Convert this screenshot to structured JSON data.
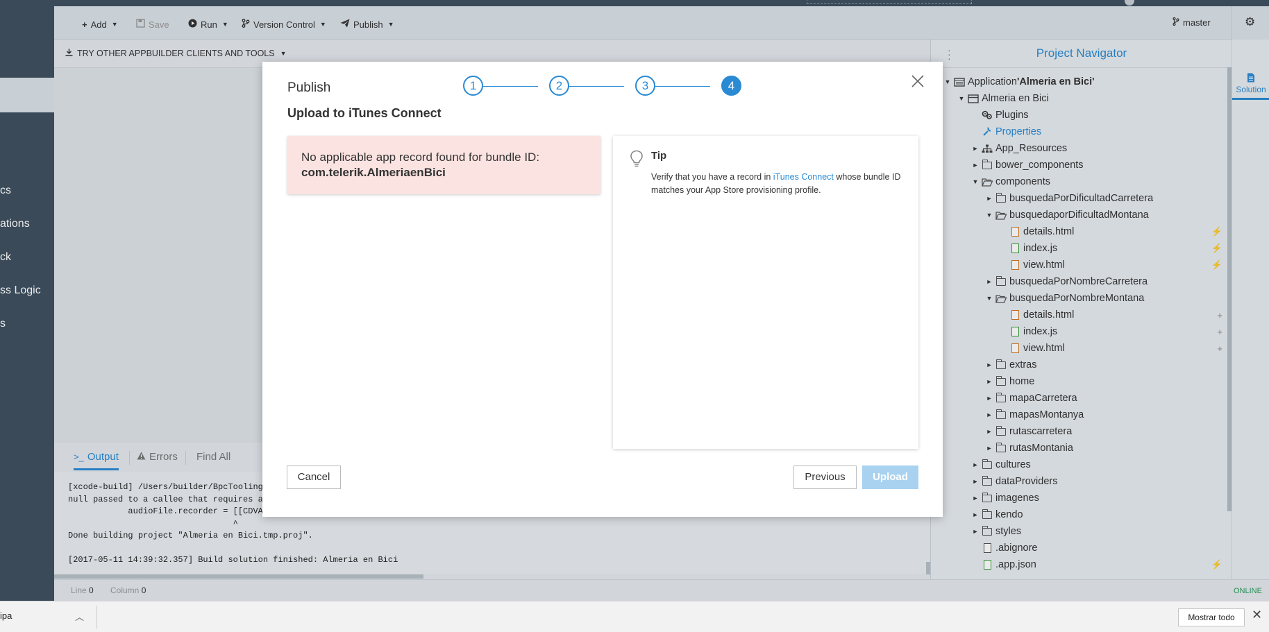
{
  "sidebar": {
    "items": [
      {
        "label": "cs"
      },
      {
        "label": "ations"
      },
      {
        "label": "ck"
      },
      {
        "label": "ss Logic"
      },
      {
        "label": "s"
      }
    ]
  },
  "toolbar": {
    "add_label": "Add",
    "save_label": "Save",
    "run_label": "Run",
    "version_control_label": "Version Control",
    "publish_label": "Publish",
    "branch_label": "master"
  },
  "subbar": {
    "try_other_label": "TRY OTHER APPBUILDER CLIENTS AND TOOLS"
  },
  "output_panel": {
    "tabs": [
      {
        "label": "Output"
      },
      {
        "label": "Errors"
      },
      {
        "label": "Find All"
      }
    ],
    "lines": [
      "[xcode-build] /Users/builder/BpcTooling/",
      "null passed to a callee that requires a",
      "            audioFile.recorder = [[CDVAu",
      "                                 ^",
      "Done building project \"Almeria en Bici.tmp.proj\".",
      "",
      "[2017-05-11 14:39:32.357] Build solution finished: Almeria en Bici"
    ]
  },
  "statusbar": {
    "line_label": "Line",
    "line_value": "0",
    "column_label": "Column",
    "column_value": "0",
    "connection_status": "ONLINE"
  },
  "navigator": {
    "title": "Project Navigator",
    "tab_label": "Solution",
    "tree": [
      {
        "label": "Application ",
        "bold_suffix": "'Almeria en Bici'",
        "type": "app"
      },
      {
        "label": "Almeria en Bici",
        "type": "project"
      },
      {
        "label": "Plugins",
        "type": "plugins"
      },
      {
        "label": "Properties",
        "type": "properties"
      },
      {
        "label": "App_Resources",
        "type": "folder"
      },
      {
        "label": "bower_components",
        "type": "folder"
      },
      {
        "label": "components",
        "type": "folder-open"
      },
      {
        "label": "busquedaPorDificultadCarretera",
        "type": "folder"
      },
      {
        "label": "busquedaporDificultadMontana",
        "type": "folder-open"
      },
      {
        "label": "details.html",
        "type": "html",
        "action": "⚡"
      },
      {
        "label": "index.js",
        "type": "js",
        "action": "⚡"
      },
      {
        "label": "view.html",
        "type": "html",
        "action": "⚡"
      },
      {
        "label": "busquedaPorNombreCarretera",
        "type": "folder"
      },
      {
        "label": "busquedaPorNombreMontana",
        "type": "folder-open"
      },
      {
        "label": "details.html",
        "type": "html",
        "action": "+"
      },
      {
        "label": "index.js",
        "type": "js",
        "action": "+"
      },
      {
        "label": "view.html",
        "type": "html",
        "action": "+"
      },
      {
        "label": "extras",
        "type": "folder"
      },
      {
        "label": "home",
        "type": "folder"
      },
      {
        "label": "mapaCarretera",
        "type": "folder"
      },
      {
        "label": "mapasMontanya",
        "type": "folder"
      },
      {
        "label": "rutascarretera",
        "type": "folder"
      },
      {
        "label": "rutasMontania",
        "type": "folder"
      },
      {
        "label": "cultures",
        "type": "folder"
      },
      {
        "label": "dataProviders",
        "type": "folder"
      },
      {
        "label": "imagenes",
        "type": "folder"
      },
      {
        "label": "kendo",
        "type": "folder"
      },
      {
        "label": "styles",
        "type": "folder"
      },
      {
        "label": ".abignore",
        "type": "file"
      },
      {
        "label": ".app.json",
        "type": "js",
        "action": "⚡"
      }
    ]
  },
  "modal": {
    "title": "Publish",
    "subtitle": "Upload to iTunes Connect",
    "steps": [
      "1",
      "2",
      "3",
      "4"
    ],
    "active_step": 4,
    "error_line1": "No applicable app record found for bundle ID:",
    "error_bundle": "com.telerik.AlmeriaenBici",
    "tip_title": "Tip",
    "tip_before": "Verify that you have a record in ",
    "tip_link": "iTunes Connect",
    "tip_after": " whose bundle ID matches your App Store provisioning profile.",
    "cancel_label": "Cancel",
    "previous_label": "Previous",
    "upload_label": "Upload"
  },
  "downloads": {
    "file_name": "ipa",
    "show_all_label": "Mostrar todo"
  },
  "colors": {
    "accent": "#2a8ad4",
    "sidebar_bg": "#3f5160",
    "error_bg": "#fbe3e1",
    "upload_disabled": "#a8d2f0"
  }
}
